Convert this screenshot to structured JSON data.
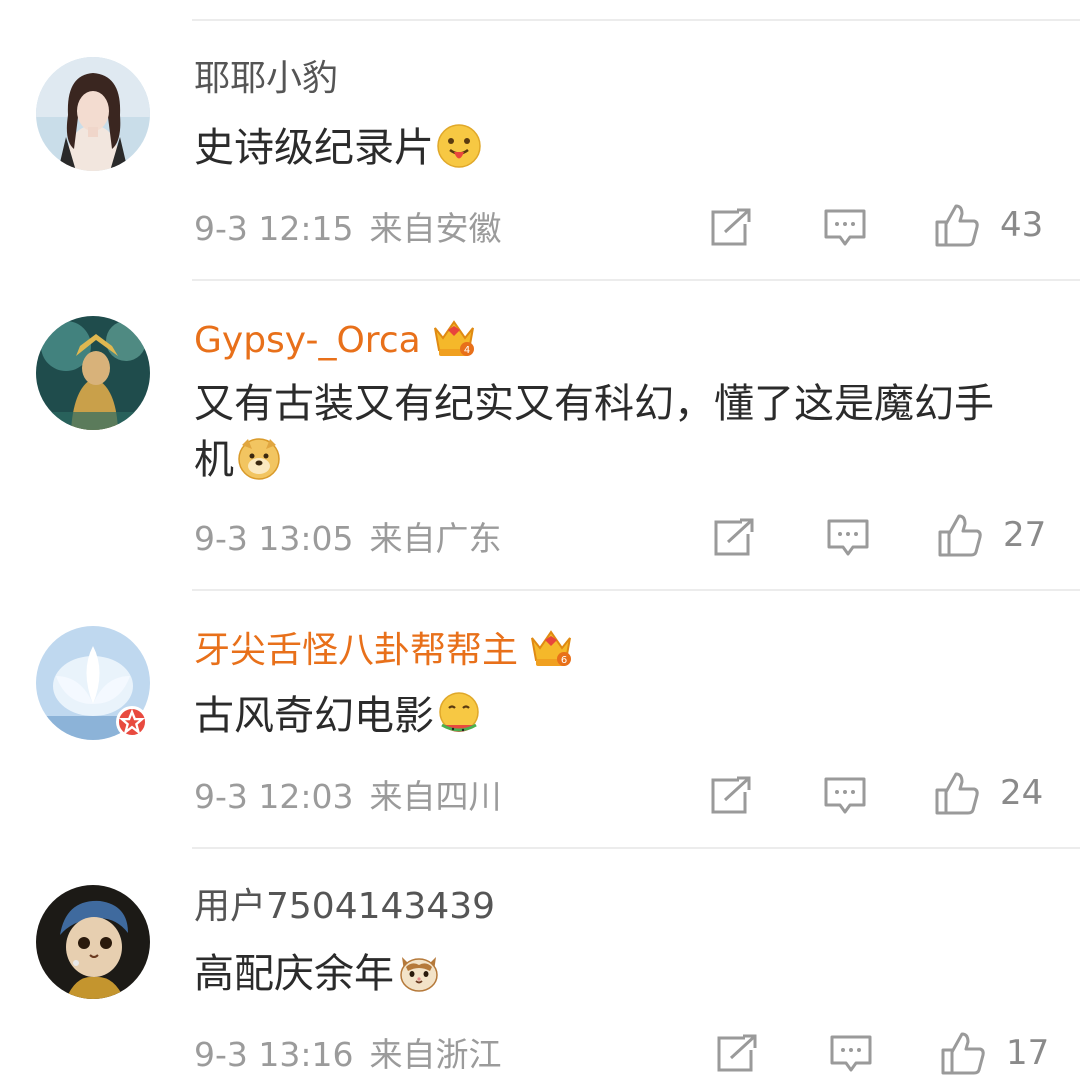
{
  "comments": [
    {
      "username": "耶耶小豹",
      "vip": false,
      "text": "史诗级纪录片",
      "emoji": "drooling-face",
      "date": "9-3 12:15",
      "location": "来自安徽",
      "likes": "43"
    },
    {
      "username": "Gypsy-_Orca",
      "vip": true,
      "vip_level": "4",
      "text": "又有古装又有纪实又有科幻，懂了这是魔幻手机",
      "emoji": "doge",
      "date": "9-3 13:05",
      "location": "来自广东",
      "likes": "27"
    },
    {
      "username": "牙尖舌怪八卦帮帮主",
      "vip": true,
      "vip_level": "6",
      "text": "古风奇幻电影",
      "emoji": "eating-watermelon",
      "date": "9-3 12:03",
      "location": "来自四川",
      "likes": "24"
    },
    {
      "username": "用户7504143439",
      "vip": false,
      "text": "高配庆余年",
      "emoji": "cat-face",
      "date": "9-3 13:16",
      "location": "来自浙江",
      "likes": "17"
    }
  ],
  "icons": {
    "repost": "repost-icon",
    "comment": "comment-icon",
    "like": "thumbs-up-icon",
    "crown": "crown-badge-icon"
  },
  "colors": {
    "vip_name": "#e8701a",
    "name": "#555555",
    "meta": "#9b9b9b",
    "divider": "#ececec"
  }
}
